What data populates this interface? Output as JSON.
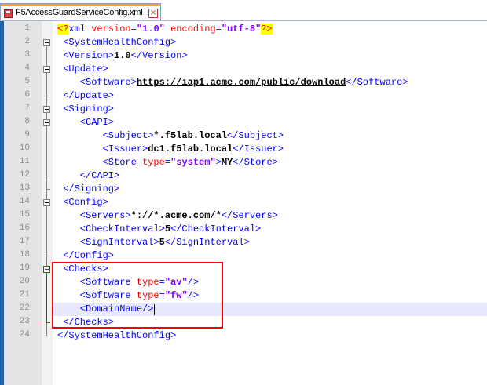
{
  "tab": {
    "label": "F5AccessGuardServiceConfig.xml",
    "close": "×"
  },
  "editor": {
    "current_line": 22,
    "lines": [
      {
        "n": "1",
        "tokens": [
          [
            "decl",
            "<?"
          ],
          [
            "tag",
            "xml "
          ],
          [
            "attr",
            "version"
          ],
          [
            "tag",
            "="
          ],
          [
            "val",
            "\"1.0\""
          ],
          [
            "tag",
            " "
          ],
          [
            "attr",
            "encoding"
          ],
          [
            "tag",
            "="
          ],
          [
            "val",
            "\"utf-8\""
          ],
          [
            "decl",
            "?>"
          ]
        ]
      },
      {
        "n": "2",
        "tokens": [
          [
            "tag",
            " <SystemHealthConfig>"
          ]
        ]
      },
      {
        "n": "3",
        "tokens": [
          [
            "tag",
            " <Version>"
          ],
          [
            "txt",
            "1.0"
          ],
          [
            "tag",
            "</Version>"
          ]
        ]
      },
      {
        "n": "4",
        "tokens": [
          [
            "tag",
            " <Update>"
          ]
        ]
      },
      {
        "n": "5",
        "tokens": [
          [
            "tag",
            "    <Software>"
          ],
          [
            "url",
            "https://iap1.acme.com/public/download"
          ],
          [
            "tag",
            "</Software>"
          ]
        ]
      },
      {
        "n": "6",
        "tokens": [
          [
            "tag",
            " </Update>"
          ]
        ]
      },
      {
        "n": "7",
        "tokens": [
          [
            "tag",
            " <Signing>"
          ]
        ]
      },
      {
        "n": "8",
        "tokens": [
          [
            "tag",
            "    <CAPI>"
          ]
        ]
      },
      {
        "n": "9",
        "tokens": [
          [
            "tag",
            "        <Subject>"
          ],
          [
            "txt",
            "*.f5lab.local"
          ],
          [
            "tag",
            "</Subject>"
          ]
        ]
      },
      {
        "n": "10",
        "tokens": [
          [
            "tag",
            "        <Issuer>"
          ],
          [
            "txt",
            "dc1.f5lab.local"
          ],
          [
            "tag",
            "</Issuer>"
          ]
        ]
      },
      {
        "n": "11",
        "tokens": [
          [
            "tag",
            "        <Store "
          ],
          [
            "attr",
            "type"
          ],
          [
            "tag",
            "="
          ],
          [
            "val",
            "\"system\""
          ],
          [
            "tag",
            ">"
          ],
          [
            "txt",
            "MY"
          ],
          [
            "tag",
            "</Store>"
          ]
        ]
      },
      {
        "n": "12",
        "tokens": [
          [
            "tag",
            "    </CAPI>"
          ]
        ]
      },
      {
        "n": "13",
        "tokens": [
          [
            "tag",
            " </Signing>"
          ]
        ]
      },
      {
        "n": "14",
        "tokens": [
          [
            "tag",
            " <Config>"
          ]
        ]
      },
      {
        "n": "15",
        "tokens": [
          [
            "tag",
            "    <Servers>"
          ],
          [
            "txt",
            "*://*.acme.com/*"
          ],
          [
            "tag",
            "</Servers>"
          ]
        ]
      },
      {
        "n": "16",
        "tokens": [
          [
            "tag",
            "    <CheckInterval>"
          ],
          [
            "txt",
            "5"
          ],
          [
            "tag",
            "</CheckInterval>"
          ]
        ]
      },
      {
        "n": "17",
        "tokens": [
          [
            "tag",
            "    <SignInterval>"
          ],
          [
            "txt",
            "5"
          ],
          [
            "tag",
            "</SignInterval>"
          ]
        ]
      },
      {
        "n": "18",
        "tokens": [
          [
            "tag",
            " </Config>"
          ]
        ]
      },
      {
        "n": "19",
        "tokens": [
          [
            "tag",
            " <Checks>"
          ]
        ]
      },
      {
        "n": "20",
        "tokens": [
          [
            "tag",
            "    <Software "
          ],
          [
            "attr",
            "type"
          ],
          [
            "tag",
            "="
          ],
          [
            "val",
            "\"av\""
          ],
          [
            "tag",
            "/>"
          ]
        ]
      },
      {
        "n": "21",
        "tokens": [
          [
            "tag",
            "    <Software "
          ],
          [
            "attr",
            "type"
          ],
          [
            "tag",
            "="
          ],
          [
            "val",
            "\"fw\""
          ],
          [
            "tag",
            "/>"
          ]
        ]
      },
      {
        "n": "22",
        "tokens": [
          [
            "tag",
            "    <DomainName/>"
          ]
        ]
      },
      {
        "n": "23",
        "tokens": [
          [
            "tag",
            " </Checks>"
          ]
        ]
      },
      {
        "n": "24",
        "tokens": [
          [
            "tag",
            "</SystemHealthConfig>"
          ]
        ]
      }
    ]
  },
  "colors": {
    "tag": "#0000ff",
    "attribute": "#ff0000",
    "attribute_value": "#8000ff",
    "declaration_bg": "#ffff00",
    "highlight_box": "#ff0000",
    "current_line": "#e8e8ff"
  }
}
